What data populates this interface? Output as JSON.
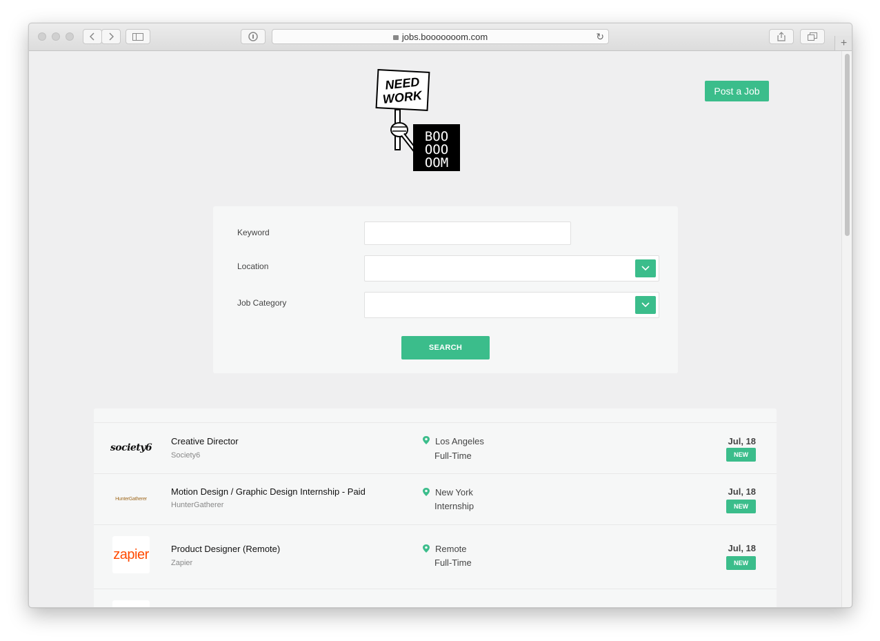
{
  "browser": {
    "url": "jobs.booooooom.com"
  },
  "header": {
    "logo_sign_text": "NEED WORK",
    "logo_box_text": "BOO OOO OOM",
    "post_job_label": "Post a Job"
  },
  "search": {
    "keyword_label": "Keyword",
    "keyword_value": "",
    "location_label": "Location",
    "location_value": "",
    "category_label": "Job Category",
    "category_value": "",
    "search_button_label": "SEARCH"
  },
  "jobs": [
    {
      "company_logo_text": "society6",
      "title": "Creative Director",
      "company": "Society6",
      "location": "Los Angeles",
      "type": "Full-Time",
      "date": "Jul, 18",
      "badge": "NEW"
    },
    {
      "company_logo_text": "HunterGatherer",
      "title": "Motion Design / Graphic Design Internship - Paid",
      "company": "HunterGatherer",
      "location": "New York",
      "type": "Internship",
      "date": "Jul, 18",
      "badge": "NEW"
    },
    {
      "company_logo_text": "zapier",
      "title": "Product Designer (Remote)",
      "company": "Zapier",
      "location": "Remote",
      "type": "Full-Time",
      "date": "Jul, 18",
      "badge": "NEW"
    }
  ],
  "colors": {
    "accent": "#3bbd8b",
    "page_bg": "#efeff0",
    "panel_bg": "#f6f7f7",
    "zapier_orange": "#ff4a00"
  }
}
